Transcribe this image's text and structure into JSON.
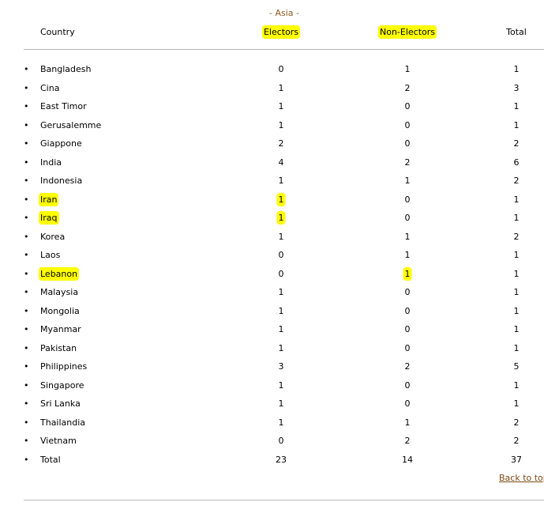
{
  "region_label": "- Asia -",
  "headers": {
    "country": "Country",
    "electors": "Electors",
    "non_electors": "Non-Electors",
    "total": "Total"
  },
  "bullet": "•",
  "highlight_color": "#ffff00",
  "rows": [
    {
      "country": "Bangladesh",
      "electors": "0",
      "non_electors": "1",
      "total": "1"
    },
    {
      "country": "Cina",
      "electors": "1",
      "non_electors": "2",
      "total": "3"
    },
    {
      "country": "East Timor",
      "electors": "1",
      "non_electors": "0",
      "total": "1"
    },
    {
      "country": "Gerusalemme",
      "electors": "1",
      "non_electors": "0",
      "total": "1"
    },
    {
      "country": "Giappone",
      "electors": "2",
      "non_electors": "0",
      "total": "2"
    },
    {
      "country": "India",
      "electors": "4",
      "non_electors": "2",
      "total": "6"
    },
    {
      "country": "Indonesia",
      "electors": "1",
      "non_electors": "1",
      "total": "2"
    },
    {
      "country": "Iran",
      "electors": "1",
      "non_electors": "0",
      "total": "1"
    },
    {
      "country": "Iraq",
      "electors": "1",
      "non_electors": "0",
      "total": "1"
    },
    {
      "country": "Korea",
      "electors": "1",
      "non_electors": "1",
      "total": "2"
    },
    {
      "country": "Laos",
      "electors": "0",
      "non_electors": "1",
      "total": "1"
    },
    {
      "country": "Lebanon",
      "electors": "0",
      "non_electors": "1",
      "total": "1"
    },
    {
      "country": "Malaysia",
      "electors": "1",
      "non_electors": "0",
      "total": "1"
    },
    {
      "country": "Mongolia",
      "electors": "1",
      "non_electors": "0",
      "total": "1"
    },
    {
      "country": "Myanmar",
      "electors": "1",
      "non_electors": "0",
      "total": "1"
    },
    {
      "country": "Pakistan",
      "electors": "1",
      "non_electors": "0",
      "total": "1"
    },
    {
      "country": "Philippines",
      "electors": "3",
      "non_electors": "2",
      "total": "5"
    },
    {
      "country": "Singapore",
      "electors": "1",
      "non_electors": "0",
      "total": "1"
    },
    {
      "country": "Sri Lanka",
      "electors": "1",
      "non_electors": "0",
      "total": "1"
    },
    {
      "country": "Thailandia",
      "electors": "1",
      "non_electors": "1",
      "total": "2"
    },
    {
      "country": "Vietnam",
      "electors": "0",
      "non_electors": "2",
      "total": "2"
    },
    {
      "country": "Total",
      "electors": "23",
      "non_electors": "14",
      "total": "37"
    }
  ],
  "back_to_top": "Back to top"
}
